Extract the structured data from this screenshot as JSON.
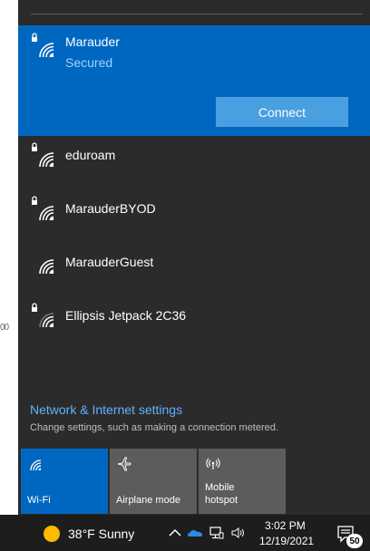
{
  "background_fragment": "00",
  "networks": [
    {
      "name": "Marauder",
      "status": "Secured",
      "secured": true,
      "selected": true
    },
    {
      "name": "eduroam",
      "secured": true
    },
    {
      "name": "MarauderBYOD",
      "secured": true
    },
    {
      "name": "MarauderGuest",
      "secured": false
    },
    {
      "name": "Ellipsis Jetpack 2C36",
      "secured": true
    }
  ],
  "connect_label": "Connect",
  "settings": {
    "title": "Network & Internet settings",
    "subtitle": "Change settings, such as making a connection metered."
  },
  "quick_actions": [
    {
      "label": "Wi-Fi",
      "icon": "wifi-icon",
      "active": true
    },
    {
      "label": "Airplane mode",
      "icon": "airplane-icon",
      "active": false
    },
    {
      "label_line1": "Mobile",
      "label_line2": "hotspot",
      "icon": "hotspot-icon",
      "active": false
    }
  ],
  "taskbar": {
    "weather": "38°F  Sunny",
    "time": "3:02 PM",
    "date": "12/19/2021",
    "notification_count": "50"
  },
  "colors": {
    "panel": "#2b2b2b",
    "accent": "#0067c0",
    "connect_button": "#4a9fe0",
    "link": "#5fb2ff",
    "tile_inactive": "#5c5c5c",
    "taskbar": "#1d1d1d"
  }
}
